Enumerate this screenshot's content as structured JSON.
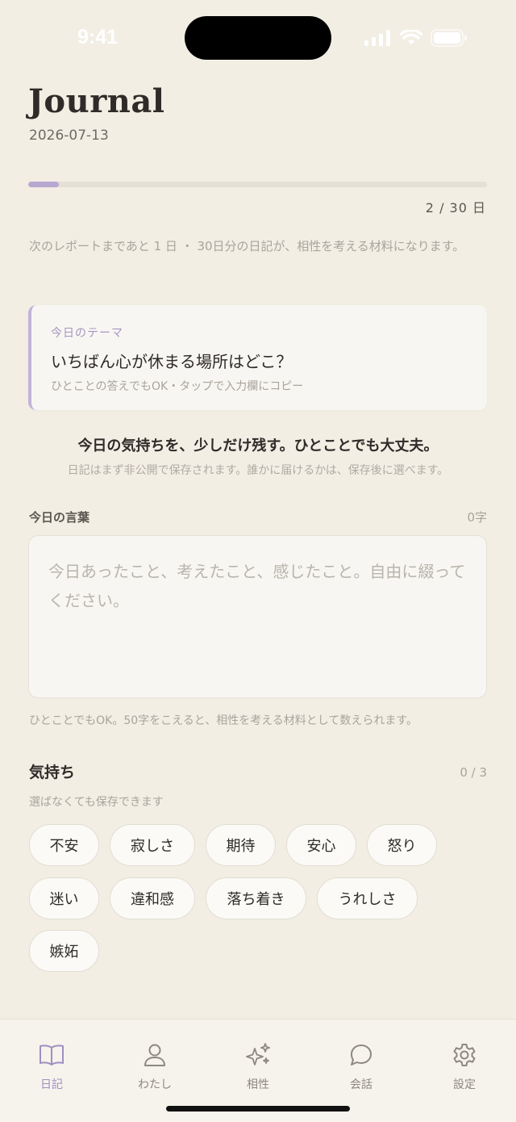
{
  "status": {
    "time": "9:41"
  },
  "header": {
    "title": "Journal",
    "date": "2026-07-13"
  },
  "progress": {
    "current": 2,
    "total": 30,
    "fraction": 0.0667,
    "label": "2 / 30 日"
  },
  "report_note": "次のレポートまであと 1 日 ・ 30日分の日記が、相性を考える材料になります。",
  "theme": {
    "label": "今日のテーマ",
    "question": "いちばん心が休まる場所はどこ？",
    "hint": "ひとことの答えでもOK・タップで入力欄にコピー"
  },
  "lead": "今日の気持ちを、少しだけ残す。ひとことでも大丈夫。",
  "sublead": "日記はまず非公開で保存されます。誰かに届けるかは、保存後に選べます。",
  "entry": {
    "label": "今日の言葉",
    "count": "0字",
    "value": "",
    "placeholder": "今日あったこと、考えたこと、感じたこと。自由に綴ってください。",
    "hint": "ひとことでもOK。50字をこえると、相性を考える材料として数えられます。"
  },
  "mood": {
    "label": "気持ち",
    "count": "0 / 3",
    "hint": "選ばなくても保存できます",
    "chips": [
      "不安",
      "寂しさ",
      "期待",
      "安心",
      "怒り",
      "迷い",
      "違和感",
      "落ち着き",
      "うれしさ",
      "嫉妬"
    ]
  },
  "tabs": [
    {
      "label": "日記",
      "icon": "book-icon",
      "active": true
    },
    {
      "label": "わたし",
      "icon": "person-icon",
      "active": false
    },
    {
      "label": "相性",
      "icon": "sparkles-icon",
      "active": false
    },
    {
      "label": "会話",
      "icon": "chat-bubble-icon",
      "active": false
    },
    {
      "label": "設定",
      "icon": "gear-icon",
      "active": false
    }
  ],
  "colors": {
    "background": "#f2eee4",
    "accent": "#b7a8d1",
    "text": "#2e2b28",
    "muted": "#a9a49c"
  }
}
